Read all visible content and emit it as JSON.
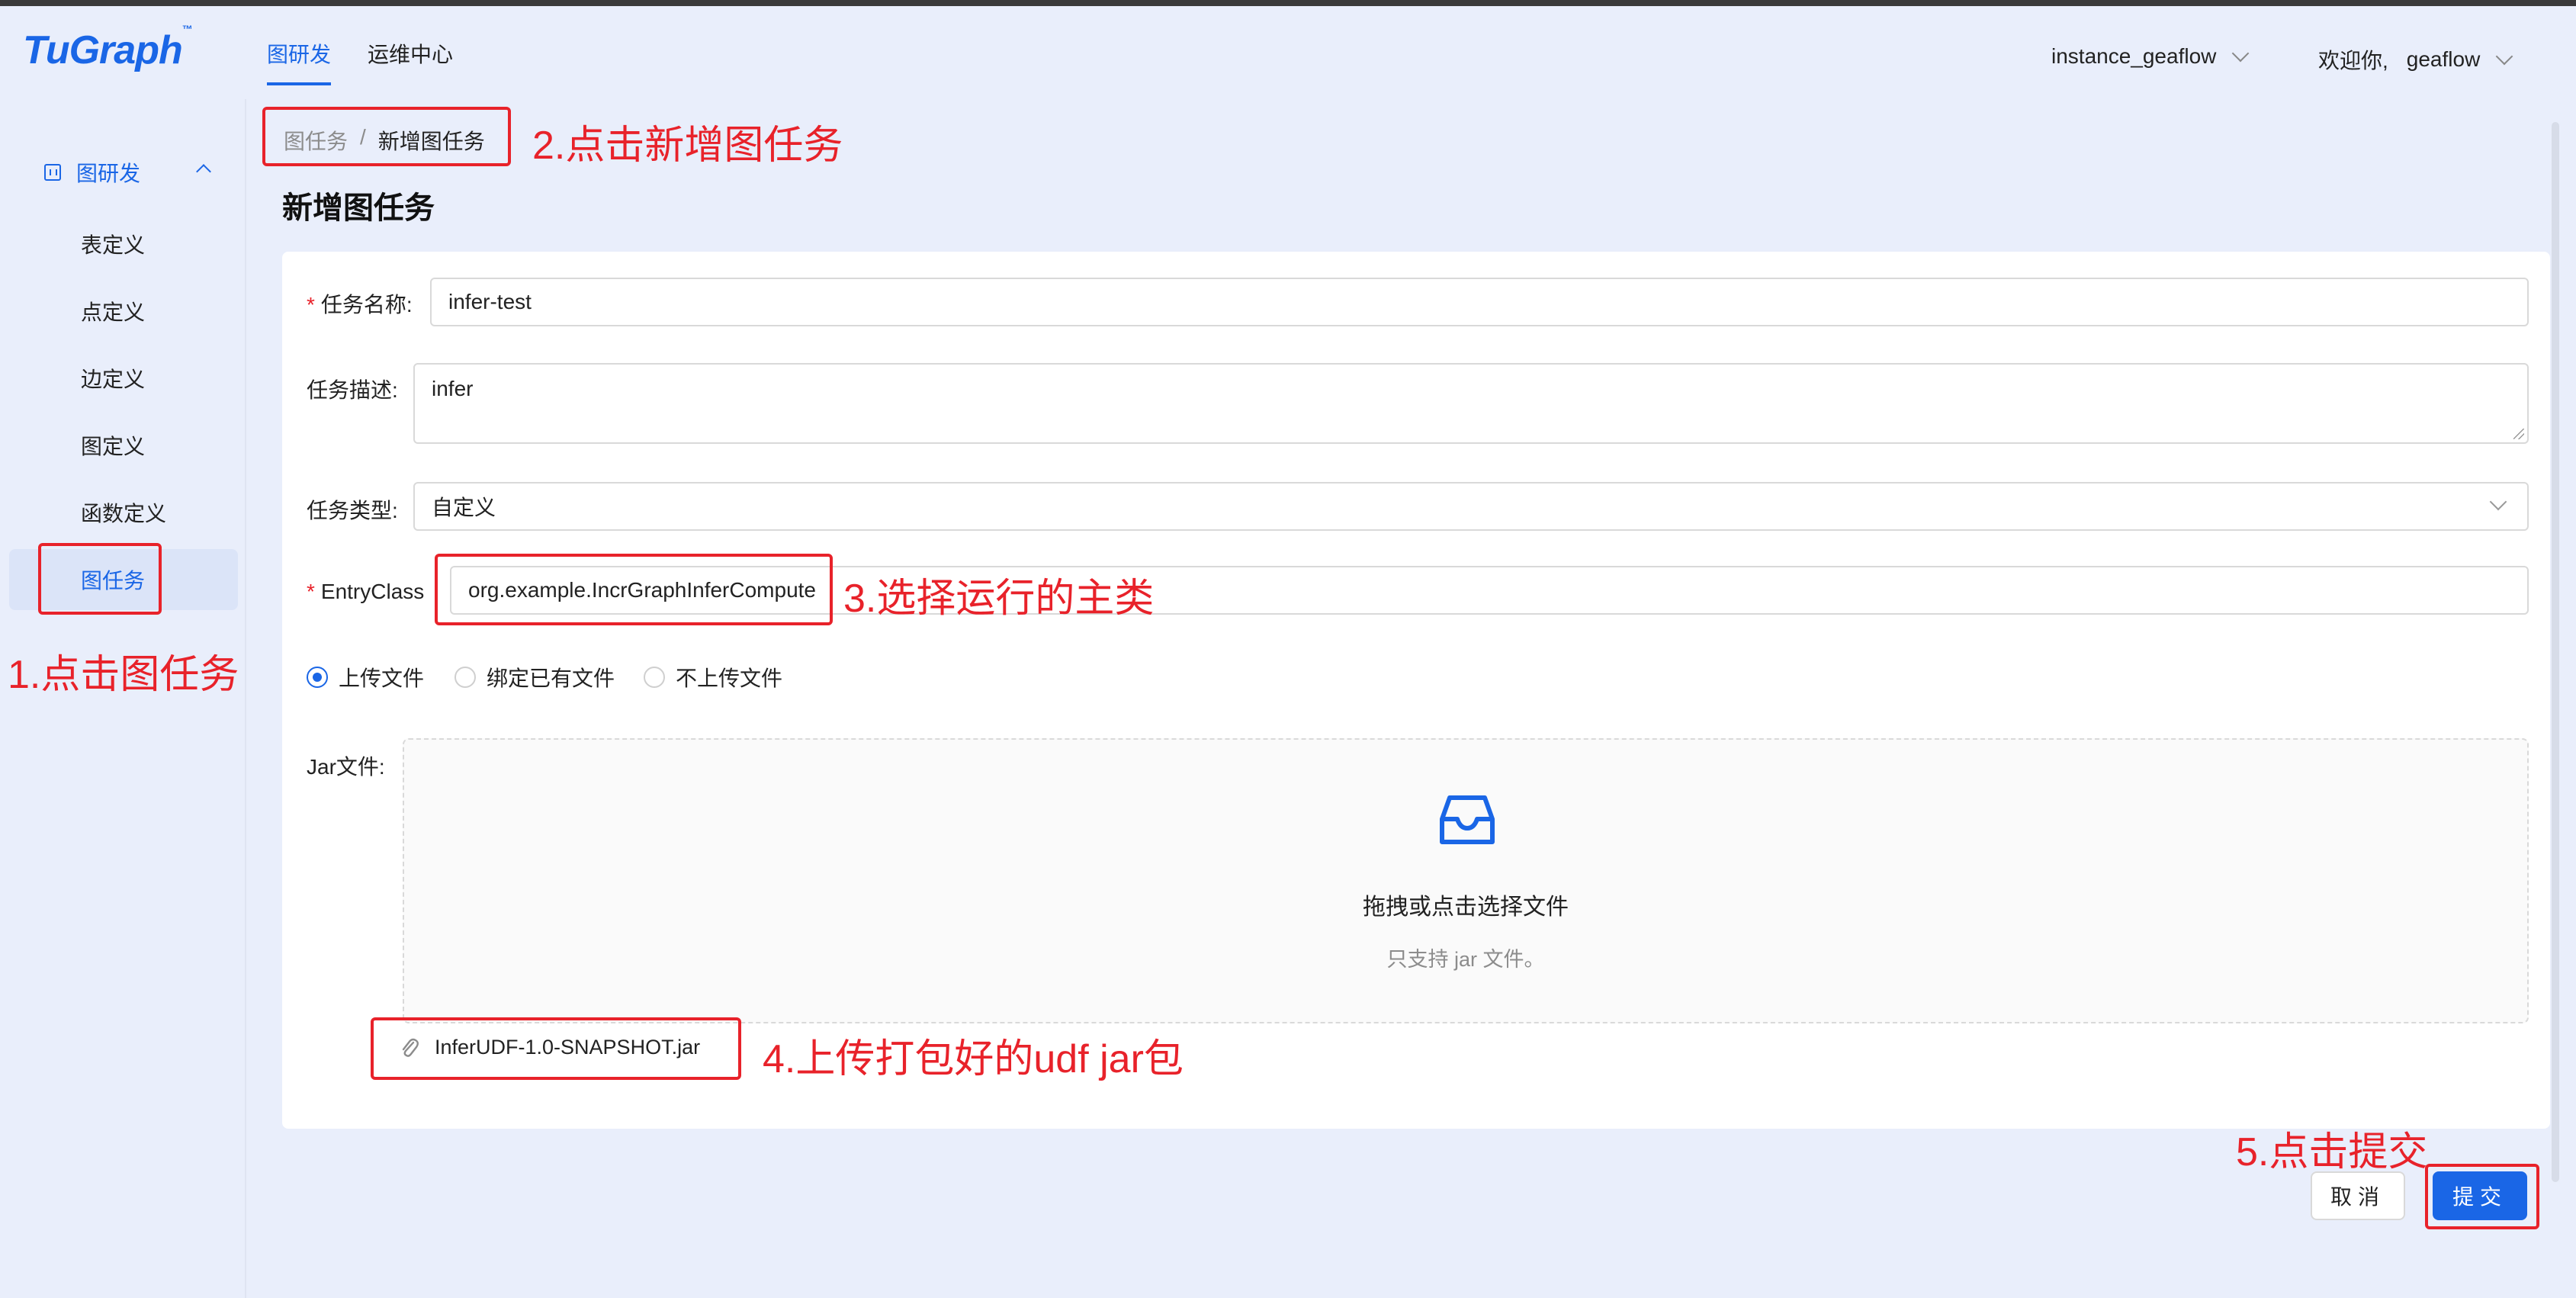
{
  "header": {
    "logo": "TuGraph",
    "logo_mark": "™",
    "tabs": [
      "图研发",
      "运维中心"
    ],
    "instance": "instance_geaflow",
    "welcome": "欢迎你,",
    "user": "geaflow"
  },
  "sidebar": {
    "group": "图研发",
    "items": [
      "表定义",
      "点定义",
      "边定义",
      "图定义",
      "函数定义",
      "图任务"
    ],
    "active_item": "图任务"
  },
  "breadcrumb": {
    "parent": "图任务",
    "separator": "/",
    "current": "新增图任务"
  },
  "page_title": "新增图任务",
  "form": {
    "task_name_label": "任务名称:",
    "task_name_value": "infer-test",
    "task_desc_label": "任务描述:",
    "task_desc_value": "infer",
    "task_type_label": "任务类型:",
    "task_type_value": "自定义",
    "entry_class_label": "EntryClass",
    "entry_class_value": "org.example.IncrGraphInferCompute",
    "radio_options": [
      "上传文件",
      "绑定已有文件",
      "不上传文件"
    ],
    "radio_selected": "上传文件",
    "jar_label": "Jar文件:",
    "dropzone_title": "拖拽或点击选择文件",
    "dropzone_hint": "只支持 jar 文件。",
    "uploaded_file": "InferUDF-1.0-SNAPSHOT.jar"
  },
  "buttons": {
    "cancel": "取消",
    "submit": "提交"
  },
  "annotations": {
    "step1": "1.点击图任务",
    "step2": "2.点击新增图任务",
    "step3": "3.选择运行的主类",
    "step4": "4.上传打包好的udf jar包",
    "step5": "5.点击提交"
  },
  "colors": {
    "accent": "#1a66e6",
    "annotation": "#e8222a",
    "background": "#e9eefb"
  },
  "icons": [
    "graph-dev-icon",
    "chevron-up-icon",
    "chevron-down-icon",
    "inbox-icon",
    "paperclip-icon"
  ]
}
